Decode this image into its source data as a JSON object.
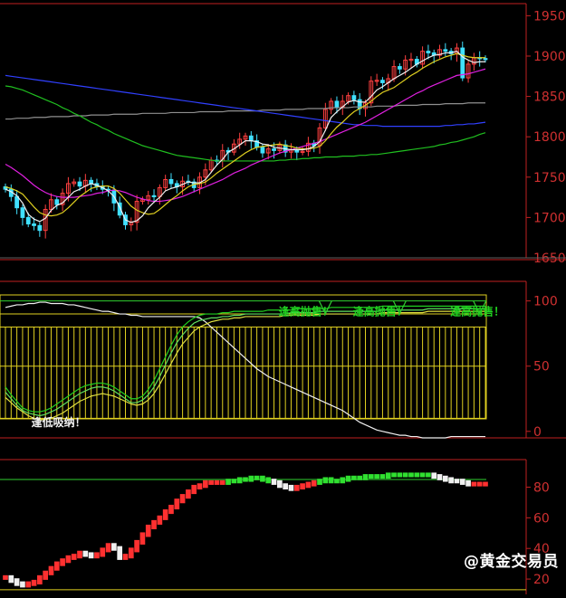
{
  "watermark": "@黄金交易员",
  "colors": {
    "bull": "#ff4040",
    "bear": "#40e0ff",
    "ma5": "#f0f0f0",
    "ma10": "#e0d020",
    "ma20": "#e020e0",
    "ma60": "#20c020",
    "ma120": "#3040ff",
    "ma250": "#909090",
    "axis": "#c02020",
    "kdj_k": "#f0f0f0",
    "kdj_d": "#e0e040",
    "kdj_j": "#20d020",
    "macd_up": "#ff3030",
    "macd_down": "#f0f0f0",
    "macd_green": "#30e030"
  },
  "chart_data": [
    {
      "type": "candlestick",
      "yticks": [
        1950,
        1900,
        1850,
        1800,
        1750,
        1700,
        1650
      ],
      "ylim": [
        1650,
        1965
      ],
      "close": [
        1735,
        1726,
        1712,
        1700,
        1692,
        1690,
        1684,
        1710,
        1722,
        1716,
        1730,
        1742,
        1744,
        1739,
        1746,
        1742,
        1738,
        1735,
        1734,
        1718,
        1703,
        1691,
        1694,
        1720,
        1722,
        1727,
        1726,
        1737,
        1747,
        1742,
        1738,
        1745,
        1744,
        1737,
        1750,
        1759,
        1771,
        1770,
        1783,
        1781,
        1791,
        1797,
        1801,
        1795,
        1787,
        1780,
        1785,
        1783,
        1790,
        1781,
        1784,
        1781,
        1782,
        1792,
        1789,
        1811,
        1834,
        1844,
        1837,
        1844,
        1851,
        1846,
        1835,
        1842,
        1869,
        1870,
        1867,
        1872,
        1887,
        1884,
        1895,
        1896,
        1890,
        1906,
        1904,
        1901,
        1908,
        1906,
        1903,
        1910,
        1873,
        1890,
        1898,
        1897,
        1896
      ],
      "ma5": [
        1735,
        1732,
        1727,
        1718,
        1704,
        1698,
        1695,
        1699,
        1709,
        1715,
        1718,
        1725,
        1732,
        1735,
        1739,
        1742,
        1740,
        1737,
        1733,
        1726,
        1713,
        1697,
        1694,
        1696,
        1702,
        1712,
        1719,
        1725,
        1733,
        1736,
        1738,
        1741,
        1744,
        1743,
        1743,
        1747,
        1756,
        1765,
        1772,
        1781,
        1785,
        1790,
        1795,
        1795,
        1794,
        1791,
        1790,
        1787,
        1786,
        1785,
        1784,
        1784,
        1784,
        1785,
        1788,
        1794,
        1808,
        1824,
        1831,
        1837,
        1843,
        1845,
        1843,
        1843,
        1850,
        1858,
        1862,
        1867,
        1872,
        1876,
        1880,
        1885,
        1890,
        1894,
        1898,
        1901,
        1902,
        1904,
        1904,
        1906,
        1899,
        1895,
        1892,
        1893,
        1893
      ],
      "ma10": [
        1738,
        1736,
        1733,
        1729,
        1721,
        1713,
        1706,
        1703,
        1702,
        1703,
        1706,
        1712,
        1719,
        1726,
        1731,
        1736,
        1738,
        1739,
        1739,
        1736,
        1730,
        1722,
        1714,
        1709,
        1706,
        1704,
        1705,
        1710,
        1716,
        1722,
        1727,
        1733,
        1738,
        1741,
        1742,
        1744,
        1749,
        1755,
        1760,
        1765,
        1770,
        1775,
        1780,
        1784,
        1787,
        1788,
        1789,
        1790,
        1791,
        1789,
        1788,
        1786,
        1785,
        1785,
        1786,
        1788,
        1795,
        1804,
        1812,
        1818,
        1825,
        1831,
        1835,
        1839,
        1844,
        1850,
        1855,
        1858,
        1861,
        1866,
        1871,
        1876,
        1880,
        1885,
        1889,
        1893,
        1896,
        1899,
        1901,
        1903,
        1901,
        1899,
        1898,
        1898,
        1898
      ],
      "ma20": [
        1766,
        1762,
        1757,
        1752,
        1746,
        1740,
        1735,
        1731,
        1728,
        1726,
        1725,
        1725,
        1725,
        1726,
        1727,
        1728,
        1730,
        1731,
        1733,
        1734,
        1733,
        1731,
        1728,
        1725,
        1723,
        1721,
        1720,
        1720,
        1721,
        1722,
        1724,
        1726,
        1729,
        1732,
        1735,
        1738,
        1741,
        1744,
        1747,
        1751,
        1755,
        1758,
        1761,
        1765,
        1768,
        1771,
        1774,
        1777,
        1780,
        1782,
        1784,
        1786,
        1788,
        1790,
        1792,
        1794,
        1797,
        1800,
        1803,
        1806,
        1809,
        1812,
        1815,
        1818,
        1822,
        1826,
        1830,
        1834,
        1838,
        1842,
        1846,
        1850,
        1854,
        1857,
        1861,
        1864,
        1867,
        1870,
        1873,
        1876,
        1877,
        1878,
        1880,
        1882,
        1884
      ],
      "ma60": [
        1863,
        1862,
        1860,
        1858,
        1855,
        1852,
        1849,
        1846,
        1843,
        1840,
        1836,
        1833,
        1829,
        1826,
        1822,
        1818,
        1815,
        1811,
        1808,
        1804,
        1801,
        1798,
        1795,
        1792,
        1789,
        1787,
        1785,
        1783,
        1781,
        1779,
        1777,
        1776,
        1775,
        1774,
        1773,
        1772,
        1771,
        1770,
        1770,
        1770,
        1770,
        1770,
        1770,
        1770,
        1770,
        1770,
        1770,
        1770,
        1771,
        1771,
        1772,
        1772,
        1773,
        1773,
        1774,
        1774,
        1775,
        1775,
        1775,
        1776,
        1776,
        1776,
        1777,
        1777,
        1778,
        1778,
        1779,
        1780,
        1781,
        1782,
        1783,
        1784,
        1785,
        1786,
        1787,
        1788,
        1790,
        1791,
        1793,
        1794,
        1796,
        1798,
        1800,
        1803,
        1805
      ],
      "ma120": [
        1876,
        1875,
        1874,
        1873,
        1872,
        1871,
        1870,
        1869,
        1868,
        1867,
        1866,
        1865,
        1864,
        1863,
        1862,
        1861,
        1860,
        1859,
        1858,
        1857,
        1856,
        1855,
        1854,
        1853,
        1852,
        1851,
        1850,
        1849,
        1848,
        1847,
        1846,
        1845,
        1844,
        1843,
        1842,
        1841,
        1840,
        1839,
        1838,
        1837,
        1836,
        1835,
        1834,
        1833,
        1832,
        1831,
        1830,
        1829,
        1828,
        1827,
        1826,
        1825,
        1824,
        1823,
        1822,
        1821,
        1820,
        1819,
        1818,
        1817,
        1816,
        1815,
        1815,
        1814,
        1814,
        1814,
        1813,
        1813,
        1813,
        1813,
        1813,
        1813,
        1813,
        1813,
        1813,
        1813,
        1813,
        1814,
        1814,
        1815,
        1815,
        1816,
        1816,
        1817,
        1818
      ],
      "ma250": [
        1822,
        1822,
        1823,
        1823,
        1823,
        1824,
        1824,
        1824,
        1825,
        1825,
        1825,
        1825,
        1826,
        1826,
        1826,
        1827,
        1827,
        1827,
        1827,
        1828,
        1828,
        1828,
        1828,
        1828,
        1829,
        1829,
        1829,
        1829,
        1829,
        1830,
        1830,
        1830,
        1830,
        1830,
        1831,
        1831,
        1831,
        1831,
        1831,
        1832,
        1832,
        1832,
        1832,
        1832,
        1832,
        1833,
        1833,
        1833,
        1833,
        1834,
        1834,
        1834,
        1834,
        1835,
        1835,
        1835,
        1835,
        1836,
        1836,
        1836,
        1836,
        1837,
        1837,
        1837,
        1837,
        1838,
        1838,
        1838,
        1838,
        1839,
        1839,
        1839,
        1839,
        1840,
        1840,
        1840,
        1840,
        1841,
        1841,
        1841,
        1841,
        1842,
        1842,
        1842,
        1842
      ]
    },
    {
      "type": "line",
      "yticks": [
        100,
        50,
        0
      ],
      "ylim": [
        -5,
        115
      ],
      "reference_lines": [
        100,
        90,
        80,
        50,
        10
      ],
      "annotations": [
        {
          "i": 2,
          "y": 4,
          "text": "逢低吸纳！"
        }
      ],
      "signals": [
        {
          "i": 51,
          "y": 89,
          "text": "逢高抛售！"
        },
        {
          "i": 64,
          "y": 89,
          "text": "逢高抛售！"
        },
        {
          "i": 81,
          "y": 89,
          "text": "逢高抛售！"
        }
      ],
      "peak_markers": [
        56,
        69,
        83
      ],
      "upper": [
        95,
        96,
        97,
        97,
        98,
        98,
        99,
        99,
        98,
        98,
        98,
        97,
        97,
        96,
        95,
        94,
        93,
        92,
        92,
        91,
        90,
        90,
        89,
        89,
        88,
        88,
        88,
        88,
        88,
        88,
        88,
        88,
        88,
        88,
        87,
        84,
        80,
        76,
        72,
        68,
        64,
        60,
        56,
        52,
        48,
        45,
        42,
        40,
        38,
        36,
        34,
        32,
        30,
        28,
        26,
        24,
        22,
        20,
        18,
        16,
        13,
        10,
        7,
        5,
        3,
        1,
        0,
        -1,
        -2,
        -3,
        -3,
        -4,
        -4,
        -5,
        -5,
        -5,
        -5,
        -5,
        -4,
        -4,
        -4,
        -4,
        -4,
        -4,
        -4
      ],
      "k": [
        30,
        25,
        20,
        16,
        14,
        13,
        12,
        13,
        15,
        17,
        20,
        23,
        26,
        29,
        31,
        33,
        34,
        34,
        33,
        31,
        28,
        25,
        22,
        22,
        24,
        28,
        34,
        42,
        51,
        60,
        68,
        74,
        79,
        83,
        85,
        86,
        87,
        87,
        88,
        88,
        89,
        89,
        90,
        90,
        90,
        90,
        90,
        90,
        90,
        90,
        91,
        91,
        91,
        91,
        91,
        92,
        92,
        92,
        92,
        92,
        92,
        92,
        92,
        92,
        92,
        92,
        93,
        93,
        93,
        93,
        93,
        93,
        93,
        93,
        94,
        94,
        94,
        94,
        94,
        94,
        94,
        94,
        94,
        94,
        94
      ],
      "d": [
        26,
        22,
        18,
        15,
        12,
        10,
        9,
        9,
        10,
        12,
        14,
        17,
        20,
        23,
        25,
        27,
        28,
        29,
        28,
        27,
        25,
        23,
        21,
        20,
        21,
        24,
        29,
        36,
        44,
        52,
        60,
        67,
        72,
        77,
        80,
        82,
        84,
        85,
        86,
        86,
        87,
        87,
        88,
        88,
        88,
        88,
        88,
        88,
        88,
        89,
        89,
        89,
        89,
        89,
        89,
        90,
        90,
        90,
        90,
        90,
        90,
        90,
        90,
        90,
        90,
        90,
        91,
        91,
        91,
        91,
        91,
        91,
        91,
        91,
        92,
        92,
        92,
        92,
        92,
        92,
        92,
        92,
        92,
        92,
        92
      ],
      "j": [
        34,
        28,
        23,
        18,
        16,
        15,
        15,
        16,
        18,
        21,
        24,
        27,
        30,
        33,
        35,
        36,
        37,
        37,
        36,
        34,
        31,
        28,
        25,
        25,
        27,
        32,
        39,
        48,
        57,
        66,
        74,
        80,
        84,
        87,
        89,
        90,
        90,
        90,
        91,
        91,
        92,
        92,
        92,
        92,
        92,
        92,
        93,
        93,
        93,
        93,
        93,
        94,
        94,
        94,
        94,
        94,
        94,
        95,
        95,
        95,
        95,
        95,
        95,
        95,
        95,
        95,
        96,
        96,
        96,
        96,
        96,
        96,
        96,
        96,
        96,
        96,
        96,
        96,
        96,
        96,
        96,
        96,
        96,
        96,
        96
      ]
    },
    {
      "type": "bar",
      "yticks": [
        80,
        60,
        40,
        20
      ],
      "ylim": [
        10,
        98
      ],
      "reference_lines": [
        85,
        13
      ],
      "values": [
        21,
        19,
        17,
        16,
        17,
        18,
        21,
        24,
        27,
        30,
        32,
        34,
        35,
        37,
        36,
        35,
        36,
        39,
        42,
        40,
        34,
        35,
        39,
        44,
        49,
        54,
        57,
        60,
        64,
        67,
        71,
        74,
        77,
        80,
        81,
        83,
        83,
        83,
        83,
        84,
        84,
        85,
        85,
        86,
        86,
        85,
        84,
        83,
        81,
        80,
        79,
        80,
        81,
        82,
        83,
        84,
        85,
        84,
        84,
        85,
        86,
        86,
        86,
        87,
        87,
        87,
        87,
        88,
        88,
        88,
        88,
        88,
        88,
        88,
        88,
        87,
        86,
        85,
        84,
        84,
        83,
        82,
        82,
        82,
        82
      ]
    }
  ]
}
